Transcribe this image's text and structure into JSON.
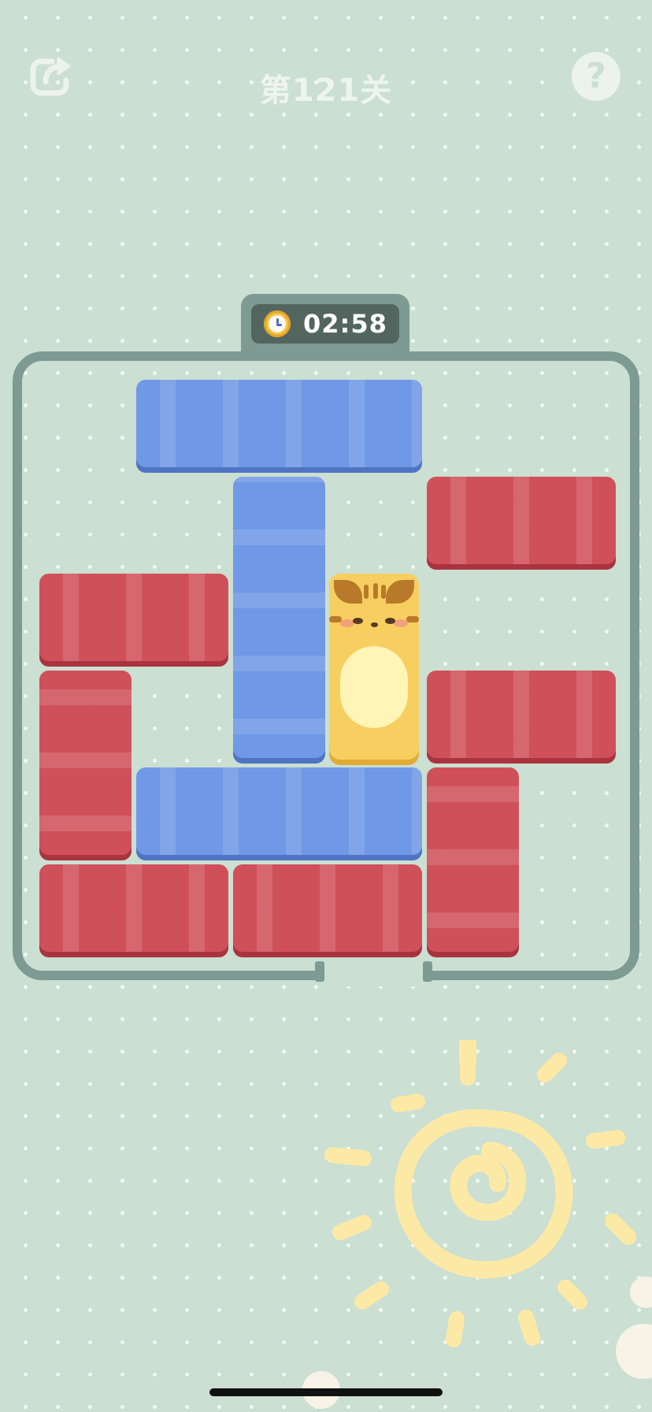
{
  "header": {
    "level_title": "第121关",
    "help_label": "?",
    "restart_icon": "restart-icon",
    "help_icon": "help-icon"
  },
  "timer": {
    "time": "02:58",
    "icon": "clock-icon"
  },
  "board": {
    "grid_columns": 6,
    "grid_rows": 6,
    "exit_side": "bottom",
    "blocks": [
      {
        "id": "blue-top",
        "color": "blue",
        "orientation": "horizontal",
        "col": 2,
        "row": 1,
        "length": 3
      },
      {
        "id": "red-top-right",
        "color": "red",
        "orientation": "horizontal",
        "col": 5,
        "row": 2,
        "length": 2
      },
      {
        "id": "blue-vertical",
        "color": "blue",
        "orientation": "vertical",
        "col": 3,
        "row": 2,
        "length": 3
      },
      {
        "id": "red-left-mid",
        "color": "red",
        "orientation": "horizontal",
        "col": 1,
        "row": 3,
        "length": 2
      },
      {
        "id": "cat",
        "color": "yellow",
        "orientation": "vertical",
        "col": 4,
        "row": 3,
        "length": 2
      },
      {
        "id": "red-left-vertical",
        "color": "red",
        "orientation": "vertical",
        "col": 1,
        "row": 4,
        "length": 2
      },
      {
        "id": "red-right-mid",
        "color": "red",
        "orientation": "horizontal",
        "col": 5,
        "row": 4,
        "length": 2
      },
      {
        "id": "blue-bottom",
        "color": "blue",
        "orientation": "horizontal",
        "col": 2,
        "row": 5,
        "length": 3
      },
      {
        "id": "red-right-vertical",
        "color": "red",
        "orientation": "vertical",
        "col": 5,
        "row": 5,
        "length": 2
      },
      {
        "id": "red-bottom-left",
        "color": "red",
        "orientation": "horizontal",
        "col": 1,
        "row": 6,
        "length": 2
      },
      {
        "id": "red-bottom-middle",
        "color": "red",
        "orientation": "horizontal",
        "col": 3,
        "row": 6,
        "length": 2
      }
    ]
  },
  "colors": {
    "background": "#cbdfd2",
    "frame": "#7d9a93",
    "red_block": "#d0505a",
    "blue_block": "#6f98e6",
    "cat": "#f7cf60",
    "sun": "#fde9a6"
  }
}
